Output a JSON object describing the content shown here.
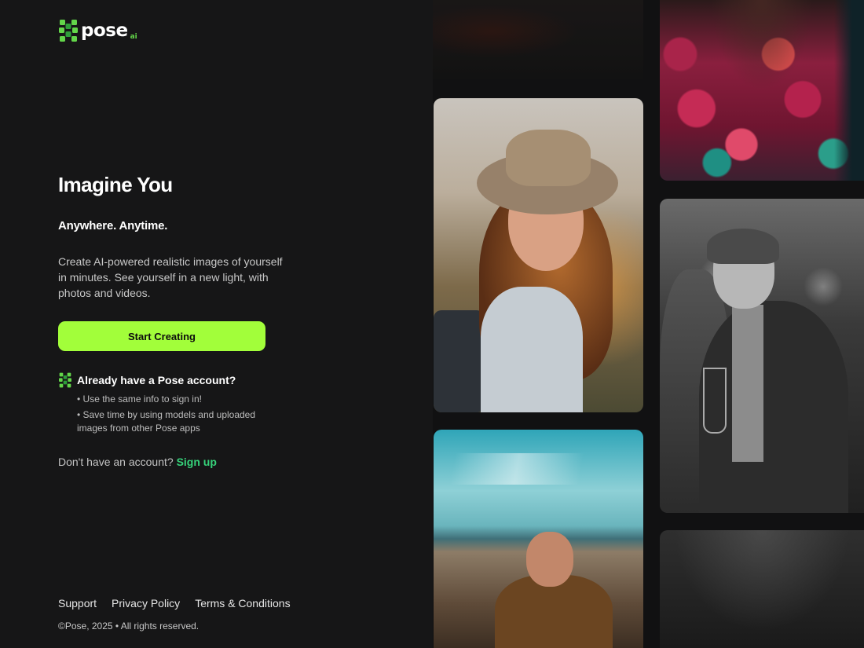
{
  "brand": {
    "name": "pose",
    "suffix": "ai",
    "accent": "#a2fe3a",
    "logo_green": "#63d64a"
  },
  "hero": {
    "title": "Imagine You",
    "subtitle": "Anywhere. Anytime.",
    "description": "Create AI-powered realistic images of yourself in minutes. See yourself in a new light, with photos and videos.",
    "cta_label": "Start Creating"
  },
  "existing_account": {
    "title": "Already have a Pose account?",
    "bullets": [
      "Use the same info to sign in!",
      "Save time by using models and uploaded images from other Pose apps"
    ]
  },
  "signup": {
    "prompt": "Don't have an account?",
    "link_label": "Sign up",
    "link_color": "#36d27a"
  },
  "footer": {
    "links": [
      "Support",
      "Privacy Policy",
      "Terms & Conditions"
    ],
    "copyright": "©Pose, 2025 • All rights reserved."
  }
}
